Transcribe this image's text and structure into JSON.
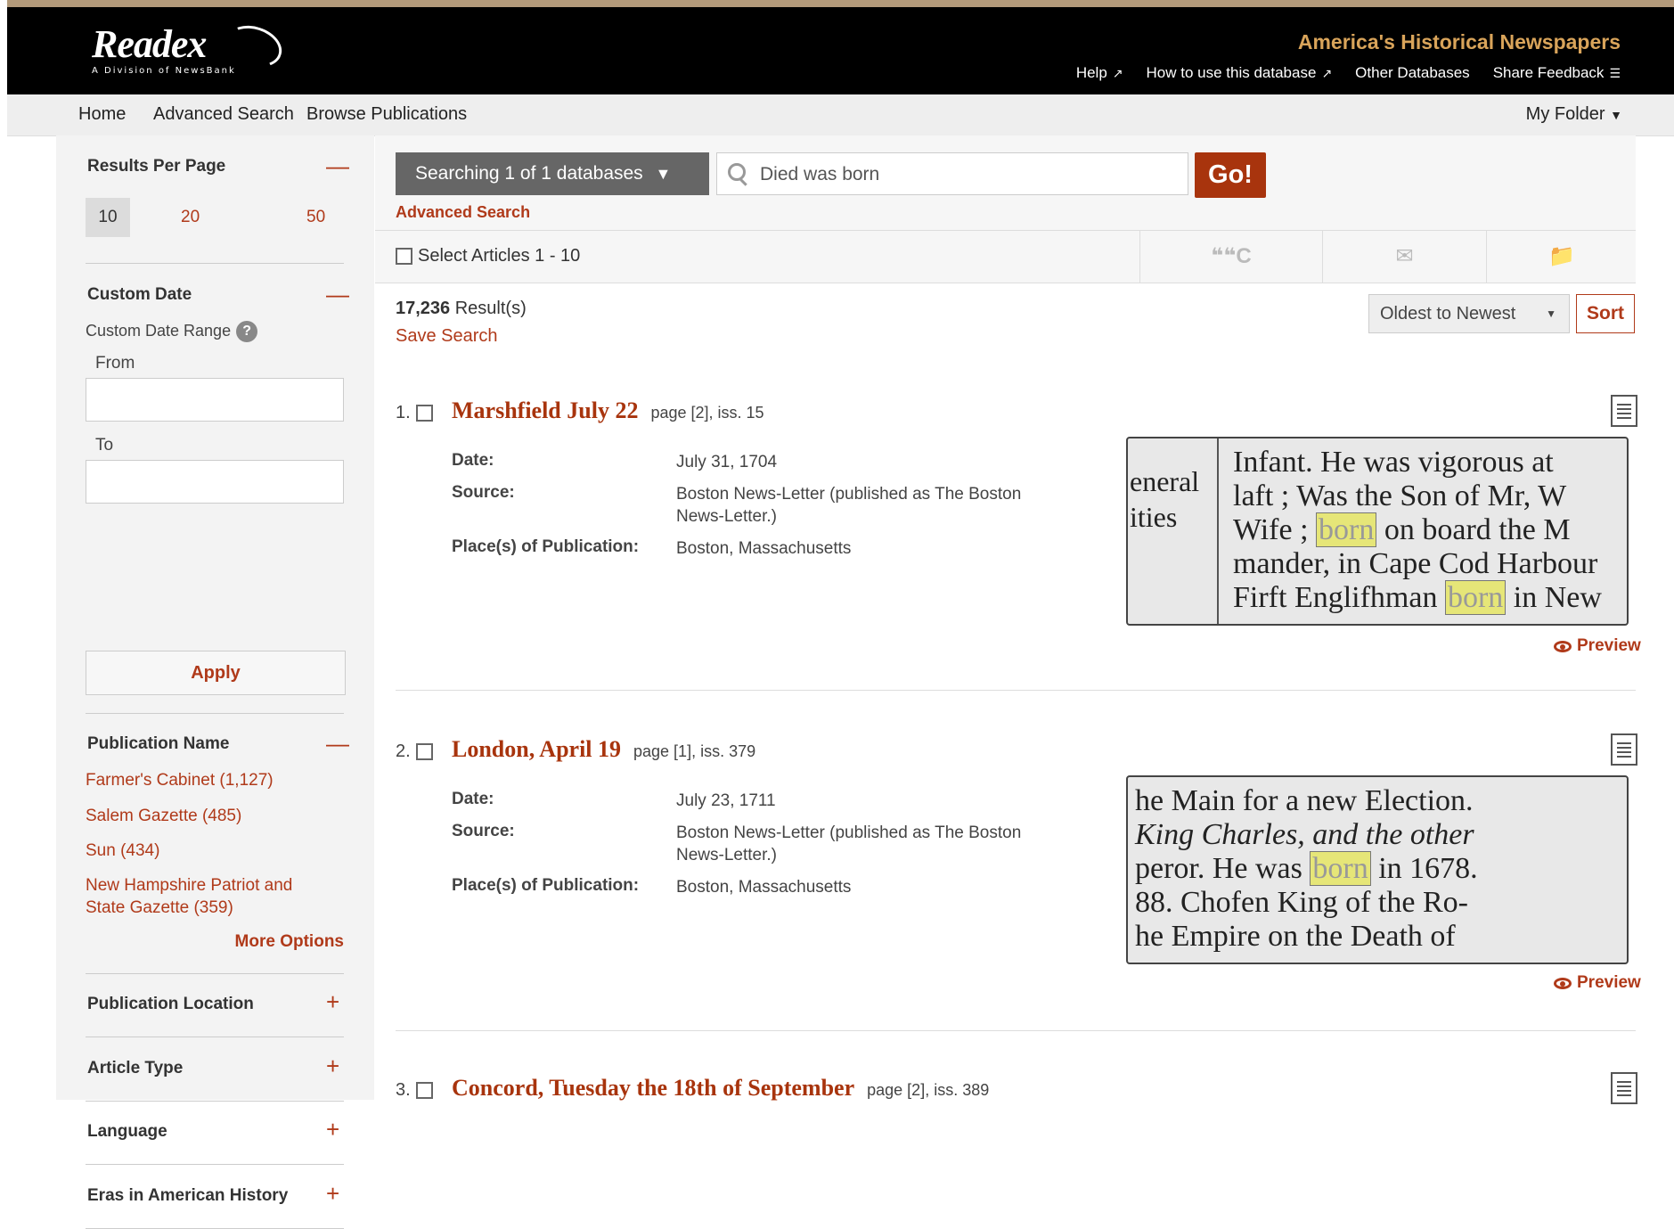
{
  "header": {
    "logo_text": "Readex",
    "logo_tagline": "A Division of NewsBank",
    "app_title": "America's Historical Newspapers",
    "links": [
      {
        "label": "Help",
        "icon": "external-link-icon"
      },
      {
        "label": "How to use this database",
        "icon": "external-link-icon"
      },
      {
        "label": "Other Databases"
      },
      {
        "label": "Share Feedback",
        "icon": "feedback-icon"
      }
    ]
  },
  "nav": {
    "items": [
      "Home",
      "Advanced Search",
      "Browse Publications"
    ],
    "my_folder": "My Folder"
  },
  "sidebar": {
    "results_per_page": {
      "title": "Results Per Page",
      "options": [
        "10",
        "20",
        "50"
      ],
      "selected": "10"
    },
    "custom_date": {
      "title": "Custom Date",
      "range_label": "Custom Date Range",
      "from_label": "From",
      "to_label": "To",
      "apply_label": "Apply"
    },
    "publication_name": {
      "title": "Publication Name",
      "items": [
        "Farmer's Cabinet (1,127)",
        "Salem Gazette (485)",
        "Sun (434)",
        "New Hampshire Patriot and State Gazette (359)"
      ],
      "more_label": "More Options"
    },
    "collapsed_facets": [
      "Publication Location",
      "Article Type",
      "Language",
      "Eras in American History"
    ]
  },
  "search": {
    "db_selector": "Searching 1 of 1 databases",
    "query": "Died was born",
    "go_label": "Go!",
    "advanced_link": "Advanced Search"
  },
  "select_bar": {
    "label": "Select Articles 1 - 10"
  },
  "results_summary": {
    "count": "17,236",
    "suffix": "Result(s)",
    "save_search": "Save Search"
  },
  "sort": {
    "selected": "Oldest to Newest",
    "button": "Sort"
  },
  "results": [
    {
      "num": "1.",
      "title": "Marshfield July 22",
      "page": "page [2], iss. 15",
      "date_label": "Date:",
      "date": "July 31, 1704",
      "source_label": "Source:",
      "source": "Boston News-Letter (published as The Boston News-Letter.)",
      "place_label": "Place(s) of Publication:",
      "place": "Boston, Massachusetts",
      "preview": "Preview"
    },
    {
      "num": "2.",
      "title": "London, April 19",
      "page": "page [1], iss. 379",
      "date_label": "Date:",
      "date": "July 23, 1711",
      "source_label": "Source:",
      "source": "Boston News-Letter (published as The Boston News-Letter.)",
      "place_label": "Place(s) of Publication:",
      "place": "Boston, Massachusetts",
      "preview": "Preview"
    },
    {
      "num": "3.",
      "title": "Concord, Tuesday the 18th of September",
      "page": "page [2], iss. 389"
    }
  ],
  "snippets": {
    "r1": {
      "l1": "Infant.  He was vigorous at",
      "l2a": "laft ; Was the Son of Mr, W",
      "l3a": "Wife ; ",
      "l3hl": "born",
      "l3b": " on board the M",
      "l4": "mander, in Cape Cod Harbour",
      "l5a": "Firft Englifhman ",
      "l5hl": "born",
      "l5b": " in New",
      "side1": "eneral",
      "side2": "ities"
    },
    "r2": {
      "l1": "he Main for a new  Election.",
      "l2": "King Charles, and the other",
      "l3a": "peror.  He was ",
      "l3hl": "born",
      "l3b": " in 1678.",
      "l4": "88.  Chofen King of the Ro-",
      "l5": "he Empire on the Death of"
    }
  },
  "colors": {
    "accent": "#b03a1a",
    "go_button": "#a8340d",
    "app_title": "#d9a45a",
    "header_bg": "#000000"
  }
}
